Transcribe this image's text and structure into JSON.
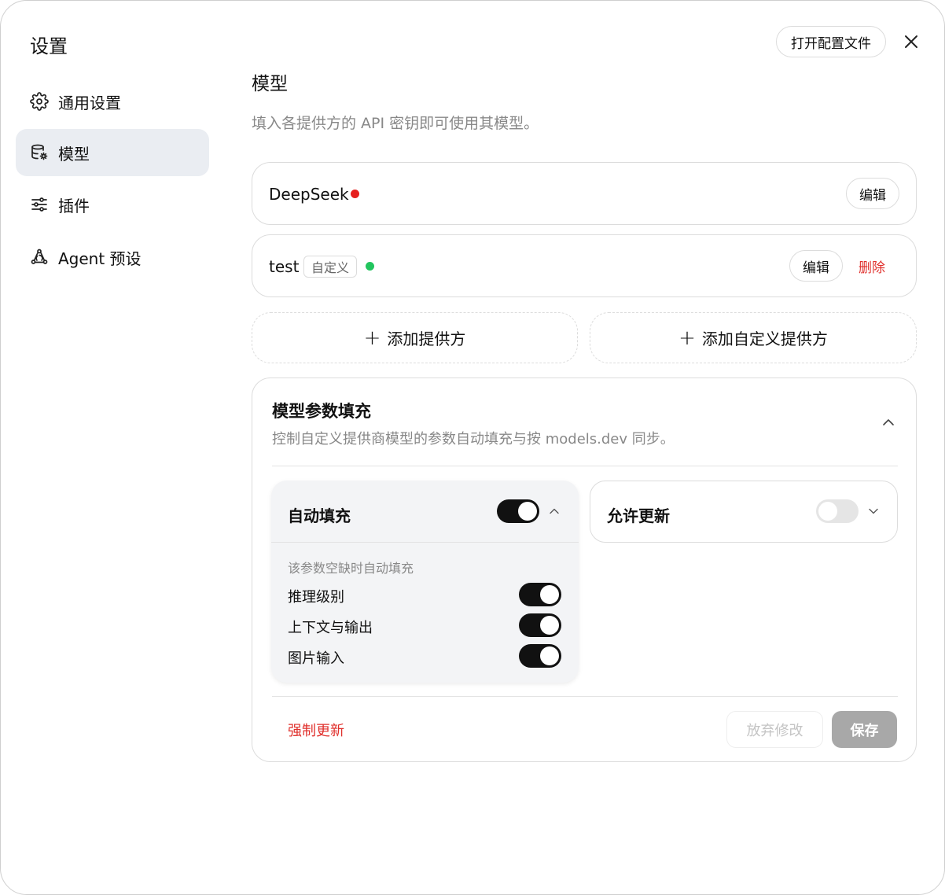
{
  "dialog": {
    "title": "设置",
    "open_config_label": "打开配置文件"
  },
  "sidebar": {
    "items": [
      {
        "label": "通用设置",
        "icon": "gear-icon"
      },
      {
        "label": "模型",
        "icon": "database-gear-icon",
        "active": true
      },
      {
        "label": "插件",
        "icon": "sliders-icon"
      },
      {
        "label": "Agent 预设",
        "icon": "agent-network-icon"
      }
    ]
  },
  "main": {
    "title": "模型",
    "description": "填入各提供方的 API 密钥即可使用其模型。",
    "providers": [
      {
        "name": "DeepSeek",
        "status_color": "#e6201e",
        "edit_label": "编辑"
      },
      {
        "name": "test",
        "tag": "自定义",
        "status_color": "#22c55e",
        "edit_label": "编辑",
        "delete_label": "删除"
      }
    ],
    "add_provider_label": "添加提供方",
    "add_custom_provider_label": "添加自定义提供方"
  },
  "params": {
    "title": "模型参数填充",
    "description": "控制自定义提供商模型的参数自动填充与按 models.dev 同步。",
    "auto_fill": {
      "title": "自动填充",
      "enabled": true,
      "hint": "该参数空缺时自动填充",
      "options": [
        {
          "label": "推理级别",
          "enabled": true
        },
        {
          "label": "上下文与输出",
          "enabled": true
        },
        {
          "label": "图片输入",
          "enabled": true
        }
      ]
    },
    "allow_update": {
      "title": "允许更新",
      "enabled": false
    },
    "force_update_label": "强制更新",
    "discard_label": "放弃修改",
    "save_label": "保存"
  },
  "colors": {
    "danger": "#e0302c",
    "toggle_on": "#111111",
    "active_nav_bg": "#eaedf2"
  }
}
